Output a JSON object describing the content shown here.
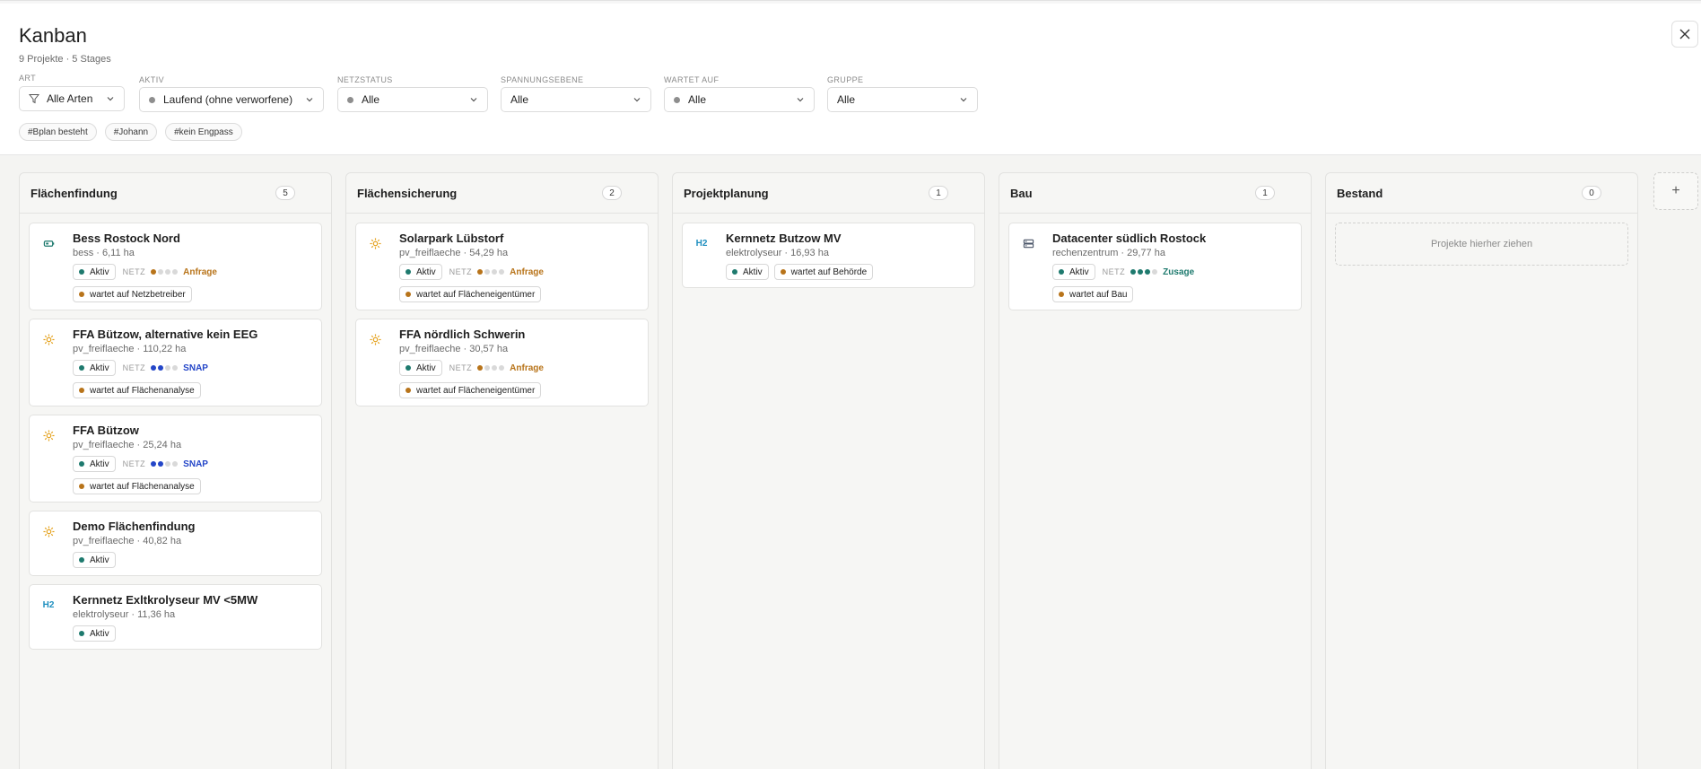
{
  "header": {
    "title": "Kanban",
    "subtitle": "9 Projekte · 5 Stages"
  },
  "filters": [
    {
      "label": "ART",
      "value": "Alle Arten",
      "icon": "filter-icon"
    },
    {
      "label": "AKTIV",
      "value": "Laufend (ohne verworfene)"
    },
    {
      "label": "NETZSTATUS",
      "value": "Alle"
    },
    {
      "label": "SPANNUNGSEBENE",
      "value": "Alle"
    },
    {
      "label": "WARTET AUF",
      "value": "Alle"
    },
    {
      "label": "GRUPPE",
      "value": "Alle"
    }
  ],
  "tags": [
    "#Bplan besteht",
    "#Johann",
    "#kein Engpass"
  ],
  "colors": {
    "aktiv": "#1e7a6e",
    "warten": "#b8741a",
    "anfrage": "#b8741a",
    "snap": "#2446c8",
    "zusage": "#1e7a6e",
    "sun": "#e4a11b",
    "h2": "#1f8fbf"
  },
  "columns": [
    {
      "title": "Flächenfindung",
      "count": "5",
      "cards": [
        {
          "icon": "battery-icon",
          "title": "Bess Rostock Nord",
          "meta": "bess · 6,11 ha",
          "status": "Aktiv",
          "netz": "NETZ",
          "netz_level": 1,
          "netz_status": "Anfrage",
          "wartet": "wartet auf Netzbetreiber"
        },
        {
          "icon": "sun-icon",
          "title": "FFA Bützow, alternative kein EEG",
          "meta": "pv_freiflaeche · 110,22 ha",
          "status": "Aktiv",
          "netz": "NETZ",
          "netz_level": 2,
          "netz_status": "SNAP",
          "wartet": "wartet auf Flächenanalyse"
        },
        {
          "icon": "sun-icon",
          "title": "FFA Bützow",
          "meta": "pv_freiflaeche · 25,24 ha",
          "status": "Aktiv",
          "netz": "NETZ",
          "netz_level": 2,
          "netz_status": "SNAP",
          "wartet": "wartet auf Flächenanalyse"
        },
        {
          "icon": "sun-icon",
          "title": "Demo Flächenfindung",
          "meta": "pv_freiflaeche · 40,82 ha",
          "status": "Aktiv"
        },
        {
          "icon": "h2-icon",
          "icon_text": "H2",
          "title": "Kernnetz Exltkrolyseur MV <5MW",
          "meta": "elektrolyseur · 11,36 ha",
          "status": "Aktiv"
        }
      ]
    },
    {
      "title": "Flächensicherung",
      "count": "2",
      "cards": [
        {
          "icon": "sun-icon",
          "title": "Solarpark Lübstorf",
          "meta": "pv_freiflaeche · 54,29 ha",
          "status": "Aktiv",
          "netz": "NETZ",
          "netz_level": 1,
          "netz_status": "Anfrage",
          "wartet": "wartet auf Flächeneigentümer"
        },
        {
          "icon": "sun-icon",
          "title": "FFA nördlich Schwerin",
          "meta": "pv_freiflaeche · 30,57 ha",
          "status": "Aktiv",
          "netz": "NETZ",
          "netz_level": 1,
          "netz_status": "Anfrage",
          "wartet": "wartet auf Flächeneigentümer"
        }
      ]
    },
    {
      "title": "Projektplanung",
      "count": "1",
      "cards": [
        {
          "icon": "h2-icon",
          "icon_text": "H2",
          "title": "Kernnetz Butzow MV",
          "meta": "elektrolyseur · 16,93 ha",
          "status": "Aktiv",
          "wartet_inline": "wartet auf Behörde"
        }
      ]
    },
    {
      "title": "Bau",
      "count": "1",
      "cards": [
        {
          "icon": "server-icon",
          "title": "Datacenter südlich Rostock",
          "meta": "rechenzentrum · 29,77 ha",
          "status": "Aktiv",
          "netz": "NETZ",
          "netz_level": 3,
          "netz_status": "Zusage",
          "wartet": "wartet auf Bau"
        }
      ]
    },
    {
      "title": "Bestand",
      "count": "0",
      "cards": [],
      "empty": "Projekte hierher ziehen"
    }
  ],
  "add_column": "+"
}
